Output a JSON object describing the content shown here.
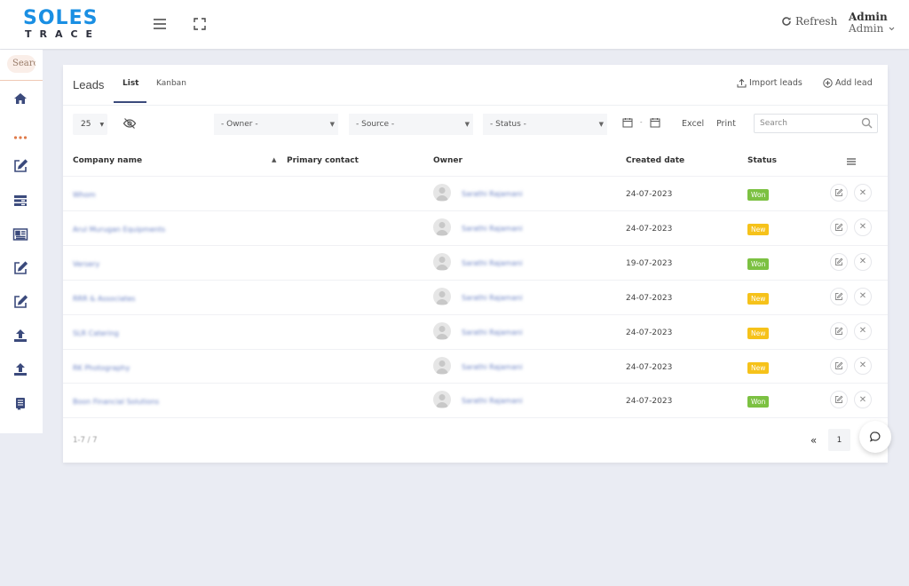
{
  "header": {
    "logo_top": "SOLES",
    "logo_bottom": "TRACE",
    "refresh_label": "Refresh",
    "user_name": "Admin",
    "user_role": "Admin"
  },
  "sidebar": {
    "search_placeholder": "Search",
    "items": [
      {
        "icon": "home-icon"
      },
      {
        "icon": "more-dots-icon"
      },
      {
        "icon": "edit-icon"
      },
      {
        "icon": "stack-icon"
      },
      {
        "icon": "newspaper-icon"
      },
      {
        "icon": "edit-icon"
      },
      {
        "icon": "edit-icon"
      },
      {
        "icon": "upload-icon"
      },
      {
        "icon": "upload-icon"
      },
      {
        "icon": "document-icon"
      }
    ]
  },
  "main": {
    "title": "Leads",
    "tabs": [
      {
        "label": "List",
        "active": true
      },
      {
        "label": "Kanban",
        "active": false
      }
    ],
    "import_label": "Import leads",
    "add_label": "Add lead"
  },
  "filters": {
    "page_size": "25",
    "owner": "- Owner -",
    "source": "- Source -",
    "status": "- Status -",
    "excel": "Excel",
    "print": "Print",
    "search_placeholder": "Search"
  },
  "table": {
    "headers": {
      "company": "Company name",
      "contact": "Primary contact",
      "owner": "Owner",
      "created": "Created date",
      "status": "Status"
    },
    "rows": [
      {
        "company": "Whom",
        "owner": "Sarathi Rajamani",
        "created": "24-07-2023",
        "status": "Won"
      },
      {
        "company": "Arul Murugan Equipments",
        "owner": "Sarathi Rajamani",
        "created": "24-07-2023",
        "status": "New"
      },
      {
        "company": "Versery",
        "owner": "Sarathi Rajamani",
        "created": "19-07-2023",
        "status": "Won"
      },
      {
        "company": "RRR & Associates",
        "owner": "Sarathi Rajamani",
        "created": "24-07-2023",
        "status": "New"
      },
      {
        "company": "SLR Catering",
        "owner": "Sarathi Rajamani",
        "created": "24-07-2023",
        "status": "New"
      },
      {
        "company": "RK Photography",
        "owner": "Sarathi Rajamani",
        "created": "24-07-2023",
        "status": "New"
      },
      {
        "company": "Boon Financial Solutions",
        "owner": "Sarathi Rajamani",
        "created": "24-07-2023",
        "status": "Won"
      }
    ]
  },
  "footer": {
    "count": "1-7 / 7",
    "first_page": "«",
    "current_page": "1"
  },
  "colors": {
    "brand_blue": "#1a8fe3",
    "won": "#7cc142",
    "new": "#f6c21a",
    "sidebar_icon": "#3b4a7c"
  }
}
